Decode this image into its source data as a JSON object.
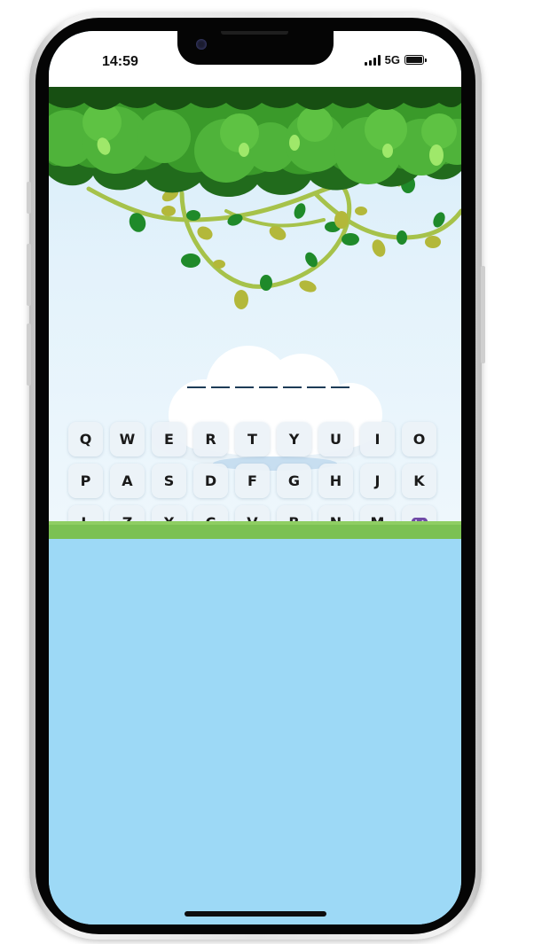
{
  "status": {
    "time": "14:59",
    "network": "5G"
  },
  "game": {
    "word_slot_count": 7,
    "keyboard": {
      "row1": [
        "Q",
        "W",
        "E",
        "R",
        "T",
        "Y",
        "U",
        "I",
        "O"
      ],
      "row2": [
        "P",
        "A",
        "S",
        "D",
        "F",
        "G",
        "H",
        "J",
        "K"
      ],
      "row3": [
        "L",
        "Z",
        "X",
        "C",
        "V",
        "B",
        "N",
        "M"
      ],
      "gamepad_icon": "gamepad-icon"
    }
  },
  "colors": {
    "sky": "#d6ecf9",
    "grass": "#7bc153",
    "water": "#9dd9f6",
    "leaf": "#2f8a25"
  }
}
